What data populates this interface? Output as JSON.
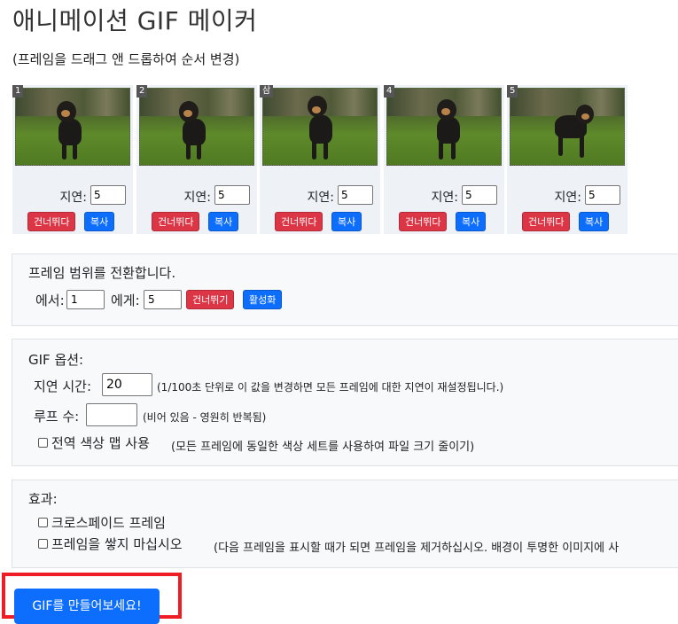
{
  "title": "애니메이션 GIF 메이커",
  "hint": "(프레임을 드래그 앤 드롭하여 순서 변경)",
  "frames": [
    {
      "number": "1",
      "delay_label": "지연:",
      "delay": "5",
      "skip_label": "건너뛰다",
      "copy_label": "복사"
    },
    {
      "number": "2",
      "delay_label": "지연:",
      "delay": "5",
      "skip_label": "건너뛰다",
      "copy_label": "복사"
    },
    {
      "number": "삼",
      "delay_label": "지연:",
      "delay": "5",
      "skip_label": "건너뛰다",
      "copy_label": "복사"
    },
    {
      "number": "4",
      "delay_label": "지연:",
      "delay": "5",
      "skip_label": "건너뛰다",
      "copy_label": "복사"
    },
    {
      "number": "5",
      "delay_label": "지연:",
      "delay": "5",
      "skip_label": "건너뛰다",
      "copy_label": "복사"
    }
  ],
  "range": {
    "title": "프레임 범위를 전환합니다.",
    "from_label": "에서:",
    "from_value": "1",
    "to_label": "에게:",
    "to_value": "5",
    "skip_label": "건너뛰기",
    "enable_label": "활성화"
  },
  "gif_options": {
    "title": "GIF 옵션:",
    "delay_label": "지연 시간:",
    "delay_value": "20",
    "delay_note": "(1/100초 단위로 이 값을 변경하면 모든 프레임에 대한 지연이 재설정됩니다.)",
    "loop_label": "루프 수:",
    "loop_value": "",
    "loop_note": "(비어 있음 - 영원히 반복됨)",
    "global_colormap_label": "전역 색상 맵 사용",
    "global_colormap_note": "(모든 프레임에 동일한 색상 세트를 사용하여 파일 크기 줄이기)",
    "global_colormap_checked": false
  },
  "effects": {
    "title": "효과:",
    "crossfade_label": "크로스페이드 프레임",
    "crossfade_checked": false,
    "no_stack_label": "프레임을 쌓지 마십시오",
    "no_stack_note": "(다음 프레임을 표시할 때가 되면 프레임을 제거하십시오. 배경이 투명한 이미지에 사",
    "no_stack_checked": false
  },
  "make_button": "GIF를 만들어보세요!",
  "colors": {
    "red": "#dc3545",
    "blue": "#0d6efd",
    "highlight": "#ee1c24"
  }
}
